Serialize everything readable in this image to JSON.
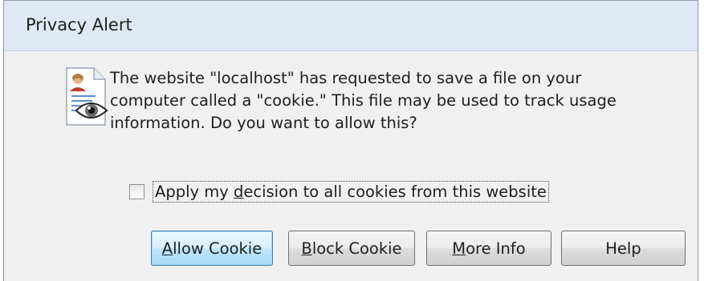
{
  "dialog": {
    "title": "Privacy Alert",
    "icon": "document-privacy-eye-icon"
  },
  "message": {
    "line1": "The website \"localhost\" has requested to save a file on your",
    "line2": "computer called a \"cookie.\"  This file may be used to track usage",
    "line3": "information. Do you want to allow this?"
  },
  "checkbox": {
    "checked": false,
    "label_before": "Apply my ",
    "label_accel": "d",
    "label_after": "ecision to all cookies from this website"
  },
  "buttons": {
    "allow": {
      "accel": "A",
      "rest": "llow Cookie"
    },
    "block": {
      "accel": "B",
      "rest": "lock Cookie"
    },
    "more": {
      "accel": "M",
      "rest": "ore Info"
    },
    "help": {
      "label": "Help"
    }
  },
  "colors": {
    "titlebar": "#dfe8f4",
    "dialog_bg": "#f0f0f0",
    "default_button": "#bee6fd"
  }
}
